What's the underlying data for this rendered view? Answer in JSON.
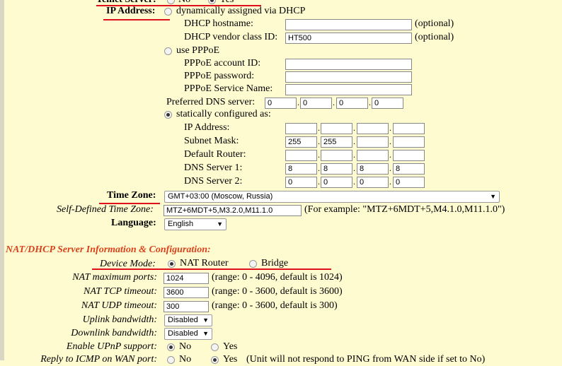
{
  "telnet": {
    "label": "Telnet Server:",
    "opt_no": "No",
    "opt_yes": "Yes"
  },
  "ip": {
    "label": "IP Address:",
    "dhcp_label": "dynamically assigned via DHCP",
    "dhcp_hostname_label": "DHCP hostname:",
    "dhcp_hostname_value": "",
    "optional": "(optional)",
    "dhcp_vendor_label": "DHCP vendor class ID:",
    "dhcp_vendor_value": "HT500",
    "pppoe_label": "use PPPoE",
    "pppoe_account_label": "PPPoE account ID:",
    "pppoe_password_label": "PPPoE password:",
    "pppoe_service_label": "PPPoE Service Name:",
    "preferred_dns_label": "Preferred DNS server:",
    "preferred_dns": [
      "0",
      "0",
      "0",
      "0"
    ],
    "static_label": "statically configured as:",
    "static_ip_label": "IP Address:",
    "static_ip": [
      "",
      "",
      "",
      ""
    ],
    "subnet_label": "Subnet Mask:",
    "subnet": [
      "255",
      "255",
      "",
      ""
    ],
    "router_label": "Default Router:",
    "router": [
      "",
      "",
      "",
      ""
    ],
    "dns1_label": "DNS Server 1:",
    "dns1": [
      "8",
      "8",
      "8",
      "8"
    ],
    "dns2_label": "DNS Server 2:",
    "dns2": [
      "0",
      "0",
      "0",
      "0"
    ]
  },
  "timezone": {
    "label": "Time Zone:",
    "value": "GMT+03:00 (Moscow, Russia)"
  },
  "self_tz": {
    "label": "Self-Defined Time Zone:",
    "value": "MTZ+6MDT+5,M3.2.0,M11.1.0",
    "example": "(For example: \"MTZ+6MDT+5,M4.1.0,M11.1.0\")"
  },
  "language": {
    "label": "Language:",
    "value": "English"
  },
  "nat": {
    "section_title": "NAT/DHCP Server Information & Configuration:",
    "device_mode_label": "Device Mode:",
    "mode_nat": "NAT Router",
    "mode_bridge": "Bridge",
    "max_ports_label": "NAT maximum ports:",
    "max_ports_value": "1024",
    "max_ports_range": "(range: 0 - 4096, default is 1024)",
    "tcp_label": "NAT TCP timeout:",
    "tcp_value": "3600",
    "tcp_range": "(range: 0 - 3600, default is 3600)",
    "udp_label": "NAT UDP timeout:",
    "udp_value": "300",
    "udp_range": "(range: 0 - 3600, default is 300)",
    "uplink_label": "Uplink bandwidth:",
    "uplink_value": "Disabled",
    "downlink_label": "Downlink bandwidth:",
    "downlink_value": "Disabled",
    "upnp_label": "Enable UPnP support:",
    "upnp_no": "No",
    "upnp_yes": "Yes",
    "icmp_label": "Reply to ICMP on WAN port:",
    "icmp_no": "No",
    "icmp_yes": "Yes",
    "icmp_note": "(Unit will not respond to PING from WAN side if set to No)"
  },
  "colors": {
    "background": "#fffbd0",
    "underline": "#e0101a",
    "section_title": "#d8431d"
  }
}
